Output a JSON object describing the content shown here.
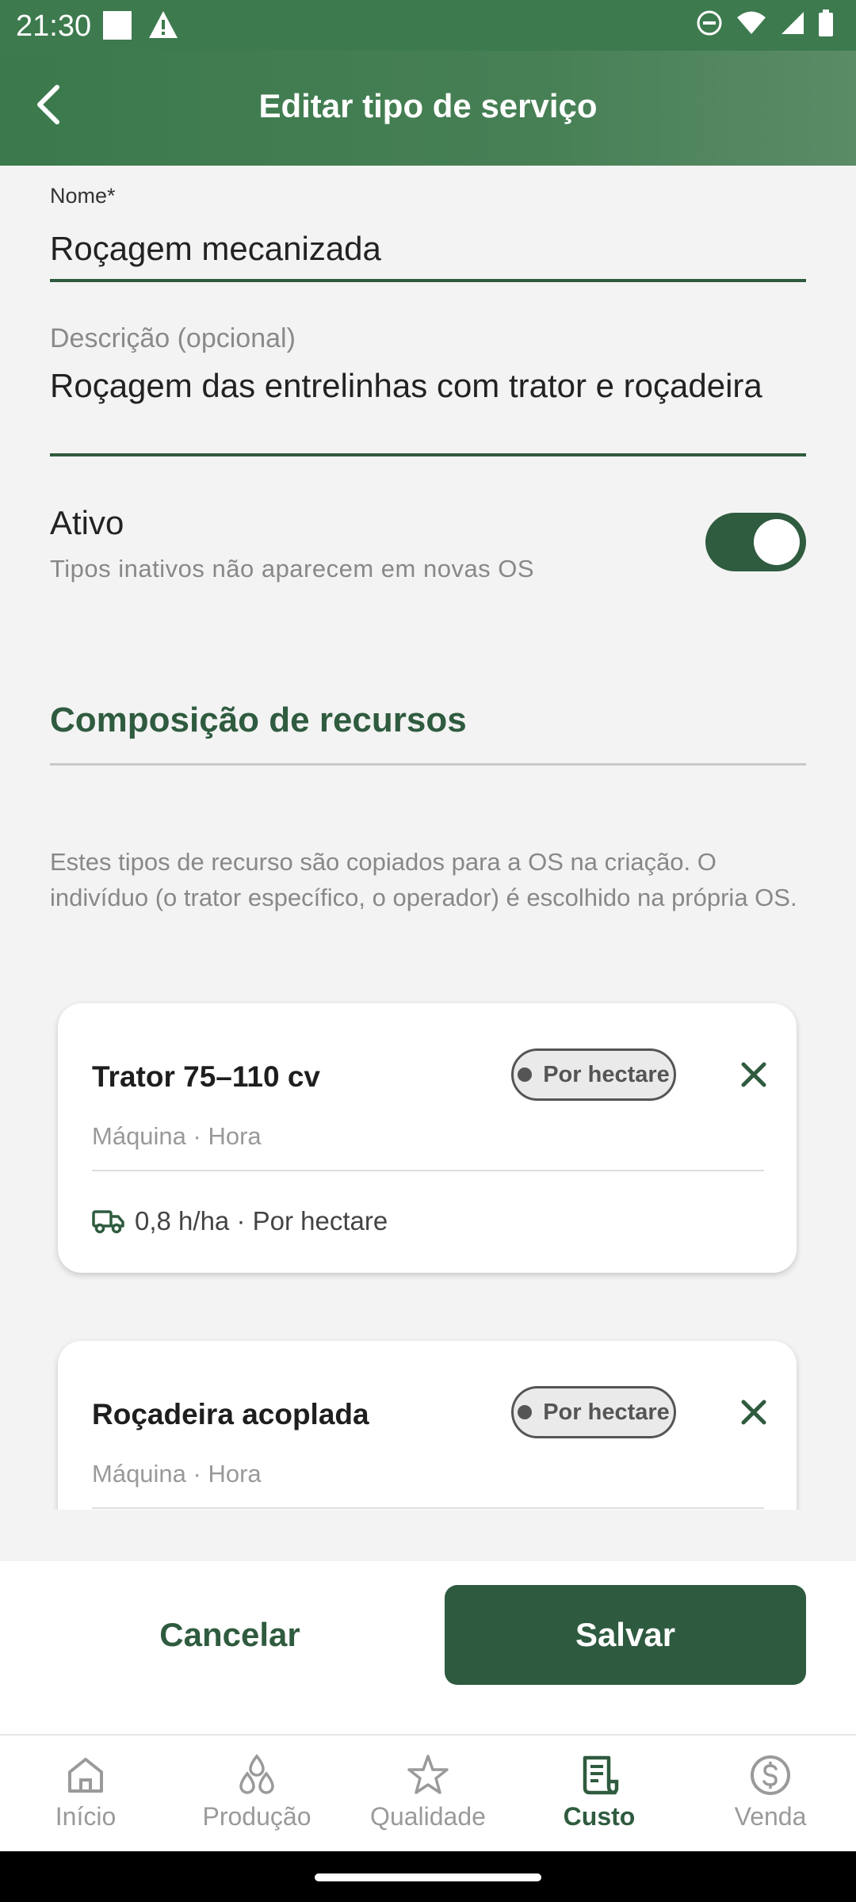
{
  "status": {
    "time": "21:30"
  },
  "header": {
    "title": "Editar tipo de serviço"
  },
  "form": {
    "name_label": "Nome*",
    "name_value": "Roçagem mecanizada",
    "description_label": "Descrição (opcional)",
    "description_value": "Roçagem das entrelinhas com trator e roçadeira",
    "active_label": "Ativo",
    "active_hint": "Tipos inativos não aparecem em novas OS",
    "active_on": true
  },
  "composition": {
    "title": "Composição de recursos",
    "help": "Estes tipos de recurso são copiados para a OS na criação. O indivíduo (o trator específico, o operador) é escolhido na própria OS.",
    "items": [
      {
        "name": "Trator 75–110 cv",
        "chip": "Por hectare",
        "meta": "Máquina · Hora",
        "detail": "0,8 h/ha · Por hectare",
        "detail_icon": "truck-icon"
      },
      {
        "name": "Roçadeira acoplada",
        "chip": "Por hectare",
        "meta": "Máquina · Hora"
      }
    ]
  },
  "actions": {
    "cancel": "Cancelar",
    "save": "Salvar"
  },
  "nav": {
    "items": [
      {
        "label": "Início",
        "icon": "home-icon"
      },
      {
        "label": "Produção",
        "icon": "drops-icon"
      },
      {
        "label": "Qualidade",
        "icon": "star-icon"
      },
      {
        "label": "Custo",
        "icon": "receipt-icon"
      },
      {
        "label": "Venda",
        "icon": "dollar-icon"
      }
    ],
    "active": "Custo"
  },
  "colors": {
    "primary": "#2f5b3f",
    "appbar": "#3d7a4e",
    "chip_border": "#555555"
  }
}
